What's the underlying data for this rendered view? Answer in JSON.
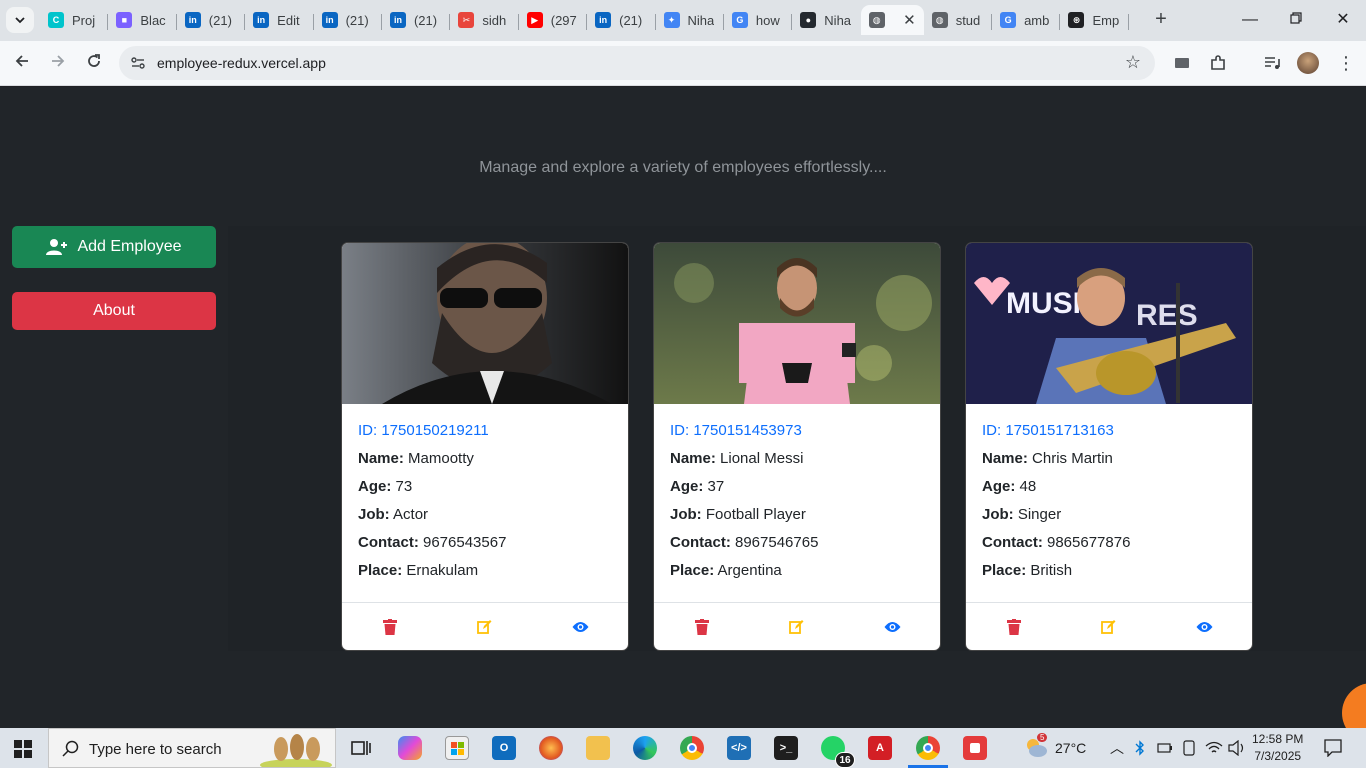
{
  "browser": {
    "tabs": [
      {
        "title": "Proj",
        "icon": "canva-icon",
        "color": "#00c4cc"
      },
      {
        "title": "Blac",
        "icon": "blackbox-icon",
        "color": "#7b61ff"
      },
      {
        "title": "(21)",
        "icon": "linkedin-icon",
        "color": "#0a66c2"
      },
      {
        "title": "Edit",
        "icon": "linkedin-icon",
        "color": "#0a66c2"
      },
      {
        "title": "(21)",
        "icon": "linkedin-icon",
        "color": "#0a66c2"
      },
      {
        "title": "(21)",
        "icon": "linkedin-icon",
        "color": "#0a66c2"
      },
      {
        "title": "sidh",
        "icon": "mentorship-icon",
        "color": "#e8453c"
      },
      {
        "title": "(297",
        "icon": "youtube-icon",
        "color": "#ff0000"
      },
      {
        "title": "(21)",
        "icon": "linkedin-icon",
        "color": "#0a66c2"
      },
      {
        "title": "Niha",
        "icon": "gemini-icon",
        "color": "#4285f4"
      },
      {
        "title": "how",
        "icon": "google-icon",
        "color": "#4285f4"
      },
      {
        "title": "Niha",
        "icon": "github-icon",
        "color": "#24292f"
      },
      {
        "title": "",
        "icon": "globe-icon",
        "color": "#5f6368",
        "active": true
      },
      {
        "title": "stud",
        "icon": "globe-icon",
        "color": "#5f6368"
      },
      {
        "title": "amb",
        "icon": "google-icon",
        "color": "#4285f4"
      },
      {
        "title": "Emp",
        "icon": "chatgpt-icon",
        "color": "#202124"
      }
    ],
    "url": "employee-redux.vercel.app"
  },
  "page": {
    "tagline": "Manage and explore a variety of employees effortlessly....",
    "add_button": "Add Employee",
    "about_button": "About",
    "labels": {
      "name": "Name:",
      "age": "Age:",
      "job": "Job:",
      "contact": "Contact:",
      "place": "Place:"
    },
    "employees": [
      {
        "id": "ID: 1750150219211",
        "name": "Mamootty",
        "age": "73",
        "job": "Actor",
        "contact": "9676543567",
        "place": "Ernakulam"
      },
      {
        "id": "ID: 1750151453973",
        "name": "Lional Messi",
        "age": "37",
        "job": "Football Player",
        "contact": "8967546765",
        "place": "Argentina"
      },
      {
        "id": "ID: 1750151713163",
        "name": "Chris Martin",
        "age": "48",
        "job": "Singer",
        "contact": "9865677876",
        "place": "British"
      }
    ]
  },
  "taskbar": {
    "search_placeholder": "Type here to search",
    "whatsapp_badge": "16",
    "weather_badge": "5",
    "temperature": "27°C",
    "time": "12:58 PM",
    "date": "7/3/2025"
  },
  "colors": {
    "add": "#198754",
    "about": "#dc3545",
    "id_text": "#0d6efd",
    "delete": "#dc3545",
    "edit": "#ffc107",
    "view": "#0d6efd"
  }
}
